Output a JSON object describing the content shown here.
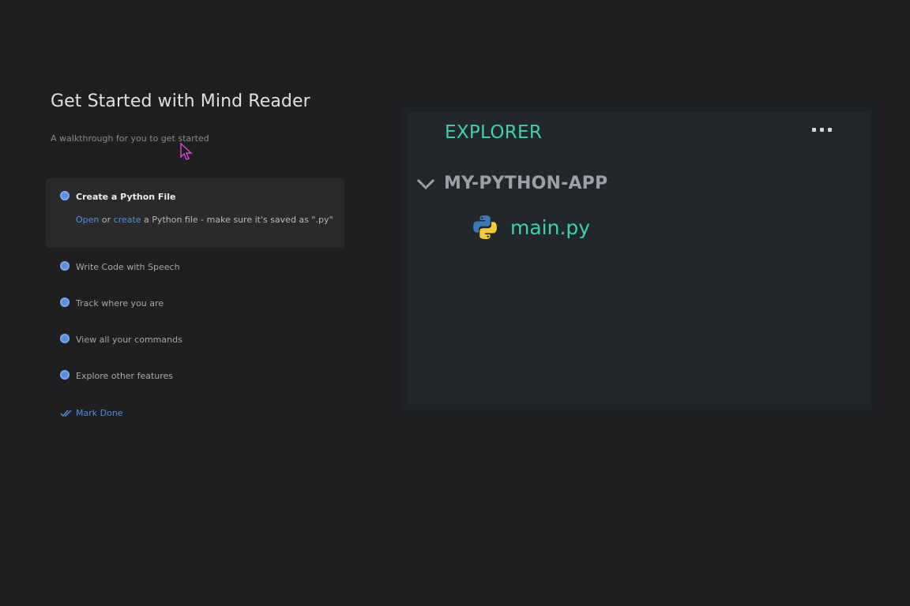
{
  "walkthrough": {
    "title": "Get Started with Mind Reader",
    "subtitle": "A walkthrough for you to get started",
    "active_step": {
      "title": "Create a Python File",
      "desc_link_open": "Open",
      "desc_or": " or ",
      "desc_link_create": "create",
      "desc_rest": " a Python file - make sure it's saved as \".py\""
    },
    "steps": [
      "Write Code with Speech",
      "Track where you are",
      "View all your commands",
      "Explore other features"
    ],
    "mark_done": "Mark Done"
  },
  "explorer": {
    "title": "EXPLORER",
    "folder": "MY-PYTHON-APP",
    "file": "main.py"
  },
  "colors": {
    "accent_teal": "#3fd0b0",
    "link_blue": "#4f8fdc",
    "background": "#1f1f22"
  }
}
